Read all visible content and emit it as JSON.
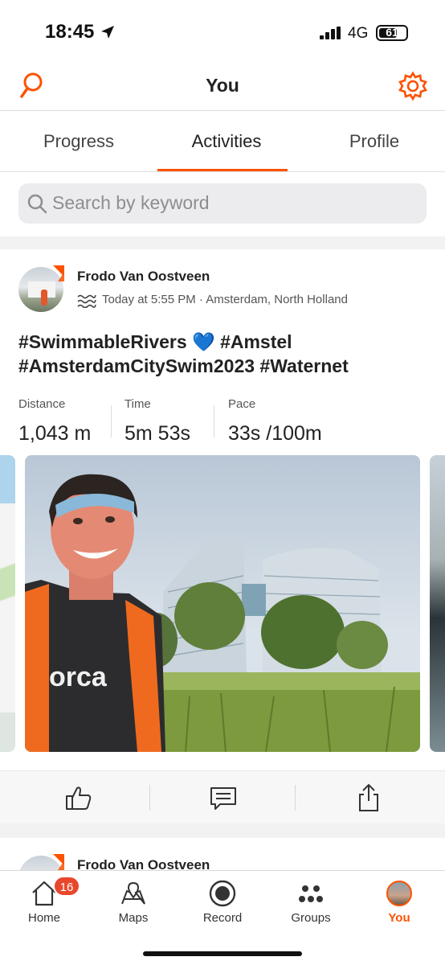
{
  "status_bar": {
    "time": "18:45",
    "network": "4G",
    "battery": "61"
  },
  "header": {
    "title": "You",
    "accent_color": "#fc5200"
  },
  "tabs": [
    {
      "label": "Progress",
      "selected": false
    },
    {
      "label": "Activities",
      "selected": true
    },
    {
      "label": "Profile",
      "selected": false
    }
  ],
  "search": {
    "placeholder": "Search by keyword"
  },
  "activity": {
    "athlete_name": "Frodo Van Oostveen",
    "meta": "Today at 5:55 PM · Amsterdam, North Holland",
    "sport_icon": "swim-icon",
    "title": "#SwimmableRivers 💙 #Amstel #AmsterdamCitySwim2023 #Waternet",
    "stats": [
      {
        "label": "Distance",
        "value": "1,043 m"
      },
      {
        "label": "Time",
        "value": "5m 53s"
      },
      {
        "label": "Pace",
        "value": "33s /100m"
      }
    ],
    "photo_text": "orca",
    "actions": [
      "like-icon",
      "comment-icon",
      "share-icon"
    ]
  },
  "next_activity": {
    "athlete_name": "Frodo Van Oostveen"
  },
  "bottom_nav": {
    "items": [
      {
        "label": "Home",
        "icon": "home-icon",
        "badge": "16"
      },
      {
        "label": "Maps",
        "icon": "map-icon"
      },
      {
        "label": "Record",
        "icon": "record-icon"
      },
      {
        "label": "Groups",
        "icon": "groups-icon"
      },
      {
        "label": "You",
        "icon": "avatar",
        "active": true
      }
    ]
  }
}
